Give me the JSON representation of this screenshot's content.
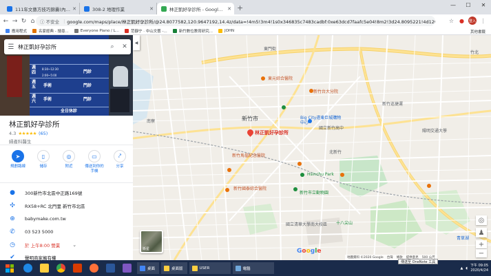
{
  "tabs": [
    {
      "title": "111年文藝方技巧錦囊(內容議程)",
      "color": "#1a73e8"
    },
    {
      "title": "308-2 地理作業",
      "color": "#1a73e8"
    },
    {
      "title": "林正凱好孕診所 - Google 地圖",
      "color": "#34a853"
    }
  ],
  "newtab_label": "+",
  "window_buttons": [
    "—",
    "☐",
    "✕"
  ],
  "nav": {
    "back": "←",
    "forward": "→",
    "reload": "↻",
    "home": "⌂"
  },
  "address": {
    "secure_label": "ⓘ 不安全",
    "url": "google.com/maps/place/林正凱好孕診所/@24.8077582,120.9647192,14.4z/data=!4m5!3m4!1s0x346835c7483cadbf:0xe63dcd7faafc5e04!8m2!3d24.8095221!4d120.9..."
  },
  "profile_label": "登入",
  "bookmarks": [
    {
      "label": "應用程式",
      "color": "#4285f4"
    },
    {
      "label": "名家經典 - 搜尋...",
      "color": "#e37400"
    },
    {
      "label": "Everyone Piano / L...",
      "color": "#777777"
    },
    {
      "label": "范靜宁 · 中山文藝 -...",
      "color": "#d93025"
    },
    {
      "label": "新竹數位教育研究...",
      "color": "#188038"
    },
    {
      "label": "JOHN",
      "color": "#fbbc04"
    }
  ],
  "bookmarks_right": "其他書籤",
  "search": {
    "query": "林正凱好孕診所",
    "menu_icon": "☰",
    "search_icon": "⌕",
    "close_icon": "✕"
  },
  "photo_board": {
    "rows": [
      [
        "週四",
        "門診"
      ],
      [
        "週五",
        "手術",
        "門診"
      ],
      [
        "週六",
        "手術",
        "門診"
      ]
    ],
    "footer": "全日休診",
    "times": [
      "8:30~12:30",
      "2:00~5:00"
    ]
  },
  "collapse_label": "◀",
  "place": {
    "name": "林正凱好孕診所",
    "rating": "4.3",
    "stars": "★★★★★",
    "reviews": "(65)",
    "category": "婦產科醫生"
  },
  "actions": [
    {
      "label": "規劃路線",
      "icon": "➤",
      "primary": true
    },
    {
      "label": "儲存",
      "icon": "▯",
      "primary": false
    },
    {
      "label": "附近",
      "icon": "◎",
      "primary": false
    },
    {
      "label": "傳送到你的手機",
      "icon": "▭",
      "primary": false
    },
    {
      "label": "分享",
      "icon": "⤤",
      "primary": false
    }
  ],
  "details": [
    {
      "icon": "●",
      "text": "300新竹市北區中正路169號"
    },
    {
      "icon": "✣",
      "text": "RX58+RC 北門里 新竹市北區"
    },
    {
      "icon": "⊕",
      "text": "babymake.com.tw"
    },
    {
      "icon": "✆",
      "text": "03 523 5000"
    },
    {
      "icon": "◷",
      "text": "於 上午8:00 營業",
      "chev": "⌄",
      "red": true
    },
    {
      "icon": "✔",
      "text": "聲明商家擁有權"
    }
  ],
  "map": {
    "labels": [
      {
        "text": "東門街",
        "cls": ""
      },
      {
        "text": "新竹市",
        "cls": "big"
      },
      {
        "text": "Big City遠東巨城購物中心",
        "cls": "blue"
      },
      {
        "text": "國立新竹高中",
        "cls": ""
      },
      {
        "text": "新竹馬偕紀念醫院",
        "cls": "orange"
      },
      {
        "text": "新竹國泰綜合醫院",
        "cls": "orange"
      },
      {
        "text": "Hsinchu Park",
        "cls": "green"
      },
      {
        "text": "新竹市立動物園",
        "cls": "green"
      },
      {
        "text": "國立清華大學南大校區",
        "cls": ""
      },
      {
        "text": "東元綜合醫院",
        "cls": "orange"
      },
      {
        "text": "新竹台大分院",
        "cls": "orange"
      },
      {
        "text": "陽明交通大學",
        "cls": ""
      },
      {
        "text": "十八尖山",
        "cls": "green"
      },
      {
        "text": "竹北",
        "cls": ""
      },
      {
        "text": "青草湖",
        "cls": "blue"
      },
      {
        "text": "南寮",
        "cls": ""
      },
      {
        "text": "新竹巡捷運",
        "cls": ""
      },
      {
        "text": "北新竹",
        "cls": ""
      }
    ],
    "place_label": "林正凱好孕診所",
    "satellite_label": "衛星",
    "google_logo": "Google",
    "attribution": [
      "地圖資料 ©2020 Google",
      "台灣",
      "條款",
      "提供意見",
      "500 公尺"
    ],
    "zoom_in": "+",
    "zoom_out": "−",
    "locate": "◎",
    "pegman": "♟"
  },
  "taskbar": {
    "windows": [
      {
        "label": "桌面",
        "color": "#4285f4"
      },
      {
        "label": "桌面版",
        "color": "#ffcf40"
      },
      {
        "label": "USER",
        "color": "#ffcf40"
      },
      {
        "label": "電腦",
        "color": "#6fa8dc"
      }
    ],
    "clock_time": "下午 09:05",
    "clock_date": "2020/4/24",
    "onenote": "傳送至 OneNote 工具"
  }
}
